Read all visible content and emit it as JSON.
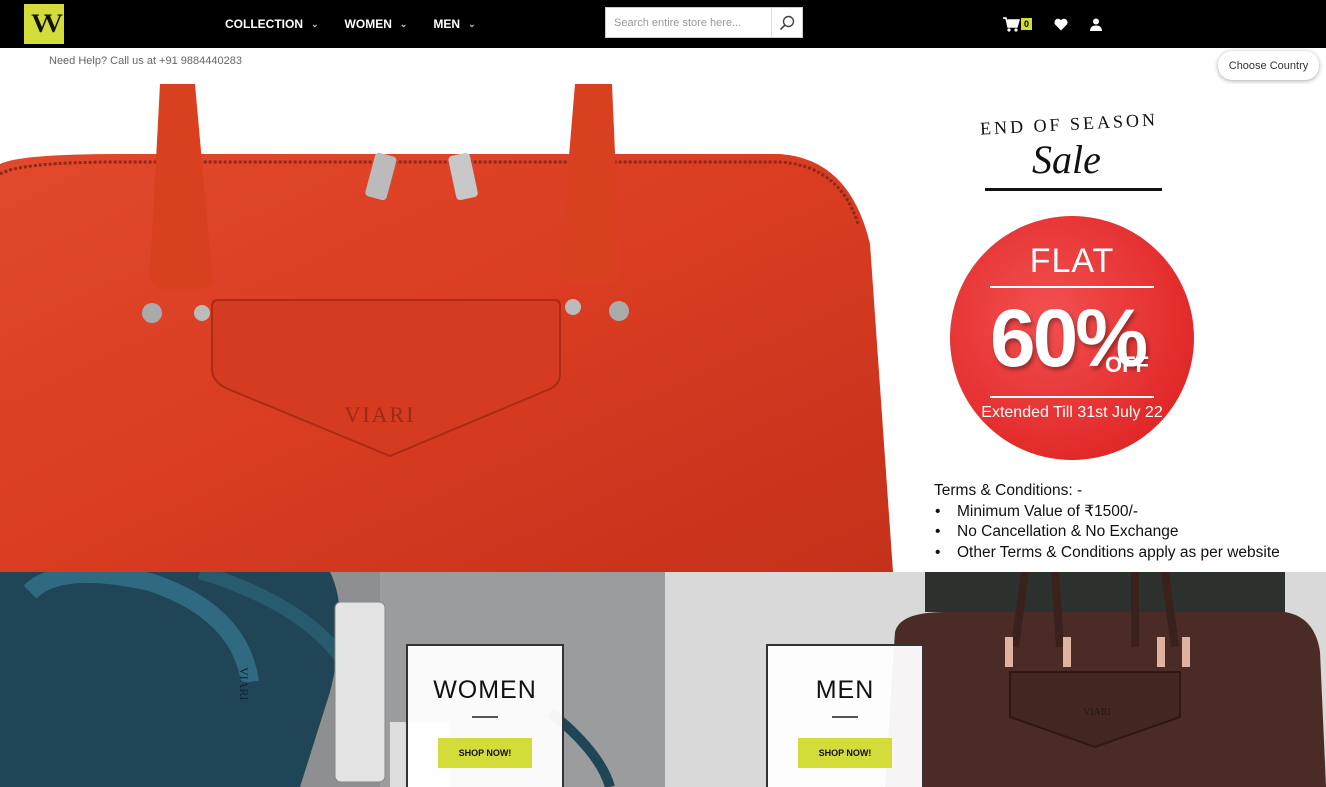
{
  "brand": {
    "logo_text": "VV",
    "logo_color": "#d4dc3a"
  },
  "nav": {
    "items": [
      {
        "label": "COLLECTION"
      },
      {
        "label": "WOMEN"
      },
      {
        "label": "MEN"
      }
    ]
  },
  "search": {
    "placeholder": "Search entire store here...",
    "icon": "search-icon"
  },
  "header_icons": {
    "cart_count": "0",
    "wishlist_icon": "heart-icon",
    "account_icon": "user-icon",
    "cart_icon": "cart-icon"
  },
  "help_text": "Need Help? Call us at +91 9884440283",
  "country_button": "Choose Country",
  "hero": {
    "bag_brand": "VIARI",
    "promo_line1": "END OF SEASON",
    "promo_line2": "Sale",
    "flat": "FLAT",
    "percent": "60%",
    "off": "OFF",
    "extended": "Extended Till 31st July 22",
    "terms_title": "Terms & Conditions: -",
    "terms": [
      "Minimum Value of  ₹1500/-",
      "No Cancellation & No Exchange",
      "Other Terms & Conditions apply as per website"
    ],
    "accent_color": "#e22a2a"
  },
  "tiles": [
    {
      "title": "WOMEN",
      "button": "SHOP NOW!"
    },
    {
      "title": "MEN",
      "button": "SHOP NOW!"
    }
  ]
}
